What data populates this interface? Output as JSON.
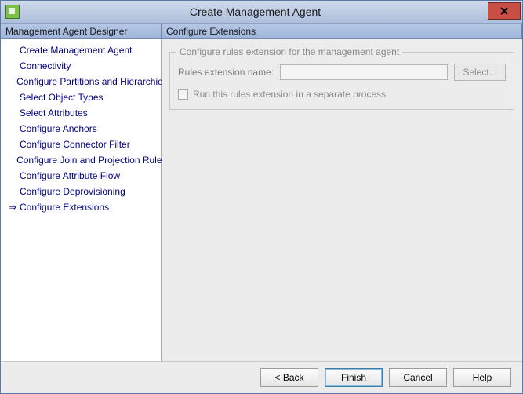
{
  "window": {
    "title": "Create Management Agent",
    "close_name": "close-icon"
  },
  "headers": {
    "left": "Management Agent Designer",
    "right": "Configure Extensions"
  },
  "nav": {
    "items": [
      {
        "label": "Create Management Agent",
        "current": false
      },
      {
        "label": "Connectivity",
        "current": false
      },
      {
        "label": "Configure Partitions and Hierarchies",
        "current": false
      },
      {
        "label": "Select Object Types",
        "current": false
      },
      {
        "label": "Select Attributes",
        "current": false
      },
      {
        "label": "Configure Anchors",
        "current": false
      },
      {
        "label": "Configure Connector Filter",
        "current": false
      },
      {
        "label": "Configure Join and Projection Rules",
        "current": false
      },
      {
        "label": "Configure Attribute Flow",
        "current": false
      },
      {
        "label": "Configure Deprovisioning",
        "current": false
      },
      {
        "label": "Configure Extensions",
        "current": true
      }
    ]
  },
  "group": {
    "legend": "Configure rules extension for the management agent",
    "rules_label": "Rules extension name:",
    "rules_value": "",
    "select_label": "Select...",
    "checkbox_label": "Run this rules extension in a separate process"
  },
  "buttons": {
    "back": "<  Back",
    "finish": "Finish",
    "cancel": "Cancel",
    "help": "Help"
  }
}
